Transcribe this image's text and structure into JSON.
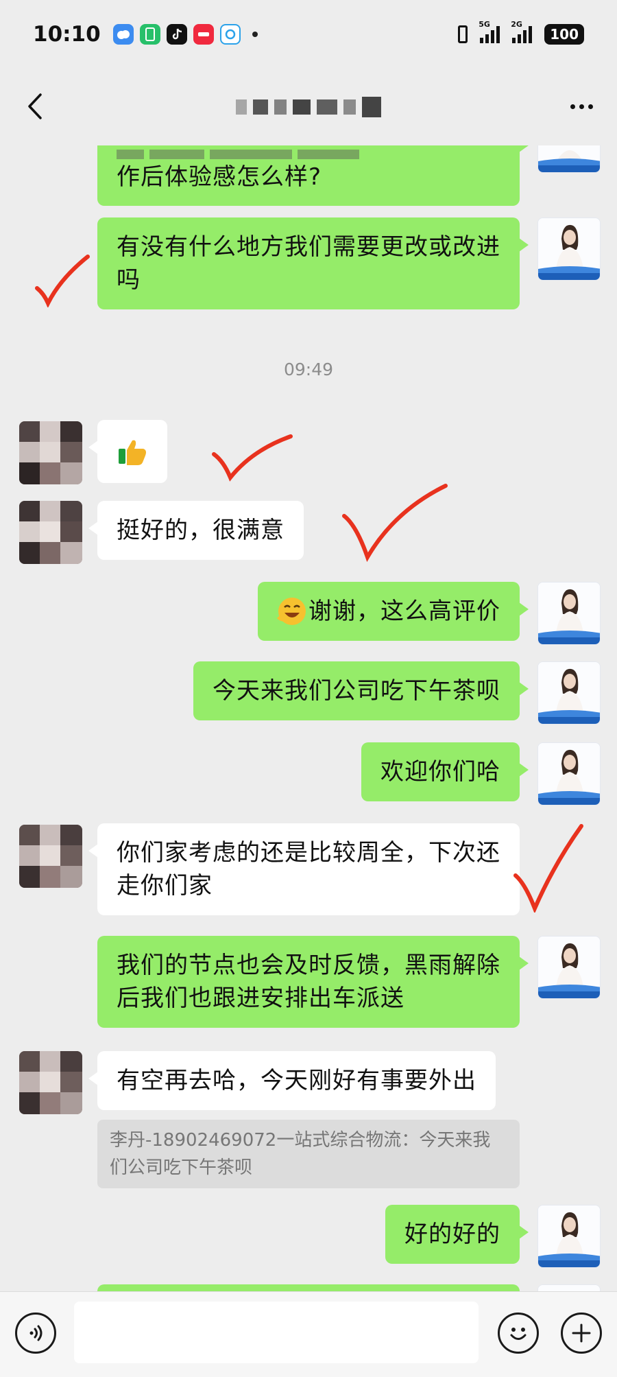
{
  "status_bar": {
    "time": "10:10",
    "signal1_label": "5G",
    "signal2_label": "2G",
    "battery": "100",
    "app_icons": [
      "weather-icon",
      "phone-manager-icon",
      "tiktok-icon",
      "red-app-icon",
      "chat-app-icon"
    ]
  },
  "nav": {
    "title": "",
    "back_icon": "chevron-left-icon",
    "more_icon": "more-dots-icon"
  },
  "messages": [
    {
      "side": "self",
      "text": "作后体验感怎么样?"
    },
    {
      "side": "self",
      "text": "有没有什么地方我们需要更改或改进吗"
    },
    {
      "side": "other",
      "sticker": "thumbs-up-icon"
    },
    {
      "side": "other",
      "text": "挺好的，很满意"
    },
    {
      "side": "self",
      "text": "谢谢，这么高评价",
      "emoji": "grinning-emoji-icon"
    },
    {
      "side": "self",
      "text": "今天来我们公司吃下午茶呗"
    },
    {
      "side": "self",
      "text": "欢迎你们哈"
    },
    {
      "side": "other",
      "text": "你们家考虑的还是比较周全，下次还走你们家"
    },
    {
      "side": "self",
      "text": "我们的节点也会及时反馈，黑雨解除后我们也跟进安排出车派送"
    },
    {
      "side": "other",
      "text": "有空再去哈，今天刚好有事要外出"
    },
    {
      "side": "self",
      "text": "好的好的"
    }
  ],
  "timestamp": "09:49",
  "quote": {
    "text": "李丹-18902469072一站式综合物流：今天来我们公司吃下午茶呗"
  },
  "input_bar": {
    "voice_icon": "voice-icon",
    "emoji_icon": "emoji-icon",
    "plus_icon": "plus-icon",
    "placeholder": ""
  },
  "colors": {
    "chat_background": "#ededed",
    "self_bubble": "#95ec69",
    "other_bubble": "#ffffff",
    "check_mark": "#e8321e"
  }
}
